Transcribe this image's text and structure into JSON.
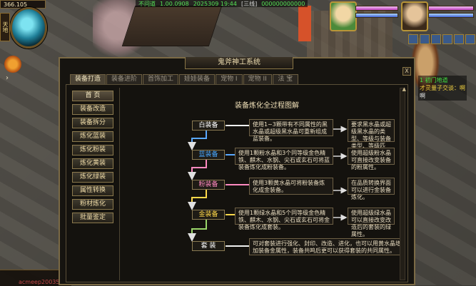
{
  "hud": {
    "coords": "366.105",
    "orb_tag": "天地",
    "top_status": [
      "不问道",
      "1.00.0908",
      "2025309 19:44",
      "[三线]",
      "000000000000"
    ],
    "bottom_name": "acmeep20035"
  },
  "side_text": {
    "line1": "1 初门地道",
    "line2": "才灵量子交谈：啊",
    "line3": "啊"
  },
  "window": {
    "title": "鬼斧神工系统",
    "close": "X",
    "tabs": [
      "装备打造",
      "装备进阶",
      "首饰加工",
      "娃娃装备",
      "宠物 I",
      "宠物 II",
      "法 宝"
    ],
    "active_tab": 0,
    "side_menu": [
      "首 页",
      "装备改造",
      "装备拆分",
      "炼化蓝装",
      "炼化粉装",
      "炼化黄装",
      "炼化绿装",
      "属性转换",
      "粉材炼化",
      "批量鉴定"
    ],
    "active_side": 0
  },
  "diagram": {
    "title": "装备炼化全过程图解",
    "stages": [
      {
        "label": "白装备",
        "color": "#ffffff"
      },
      {
        "label": "蓝装备",
        "color": "#4aa8ff"
      },
      {
        "label": "粉装备",
        "color": "#ff8ac0"
      },
      {
        "label": "金装备",
        "color": "#ffd84a"
      },
      {
        "label": "套 装",
        "color": "#ffffff"
      }
    ],
    "left_desc": [
      "使用1~3颗带有不同属性的黑水晶或超级黑水晶可重新组成蓝装备。",
      "使用1颗粉水晶和3个同等级金色精铁、麒木、水钢、尖石或玄石可将蓝装备炼化成粉装备。",
      "使用3颗黄水晶可将粉装备炼化成金装备。",
      "使用1颗绿水晶和5个同等级金色精铁、麒木、水钢、尖石或玄石可将金装备炼化成套装。",
      "可对套装进行强化、封印、改造、进化，也可以用黄水晶增加装备金属性，装备共鸣后更可以获得套装的共同属性。"
    ],
    "right_desc": [
      "要求黑水晶或超级黑水晶的类型、等级与装备类型、等级匹配。",
      "使用超级粉水晶可直接改变装备的粉属性。",
      "在品质转换界面可以进行金装备炼化。",
      "使用超级绿水晶可以直接改变改造后的套装的绿属性。"
    ]
  }
}
